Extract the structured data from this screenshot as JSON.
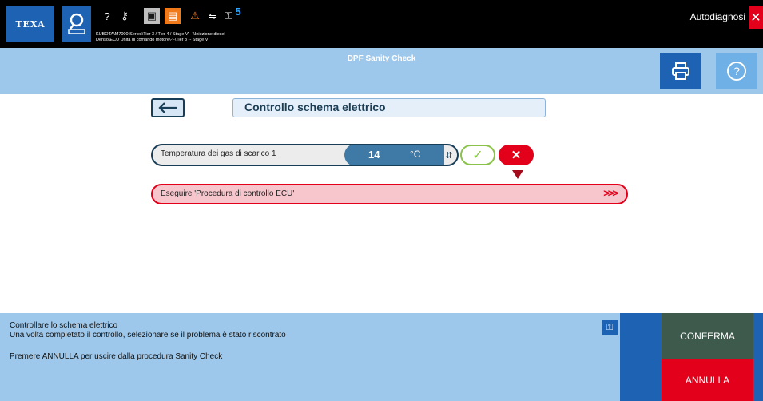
{
  "topbar": {
    "brand": "TEXA",
    "path_line1": "KUBOTA\\M7000 Series\\Tier 3 / Tier 4 / Stage V\\--\\\\Iniezione diesel",
    "path_line2": "Denso\\ECU Unità di comando motore\\-\\-\\Tier 3 -- Stage V",
    "badge_count": "5",
    "mode_label": "Autodiagnosi"
  },
  "header": {
    "title": "DPF Sanity Check"
  },
  "step": {
    "title": "Controllo schema elettrico"
  },
  "measurement": {
    "label": "Temperatura dei gas di scarico 1",
    "value": "14",
    "unit": "°C"
  },
  "procedure": {
    "label": "Eseguire 'Procedura di controllo ECU'",
    "go_symbol": ">>>"
  },
  "footer": {
    "line1": "Controllare lo schema elettrico",
    "line2": "Una volta completato il controllo, selezionare se il problema è stato riscontrato",
    "line3": "Premere ANNULLA per uscire dalla procedura Sanity Check",
    "confirm_label": "CONFERMA",
    "cancel_label": "ANNULLA"
  },
  "colors": {
    "brand_blue": "#1d62b3",
    "header_blue": "#9ec8eb",
    "danger": "#e2001a",
    "ok_green": "#8bc34a"
  }
}
